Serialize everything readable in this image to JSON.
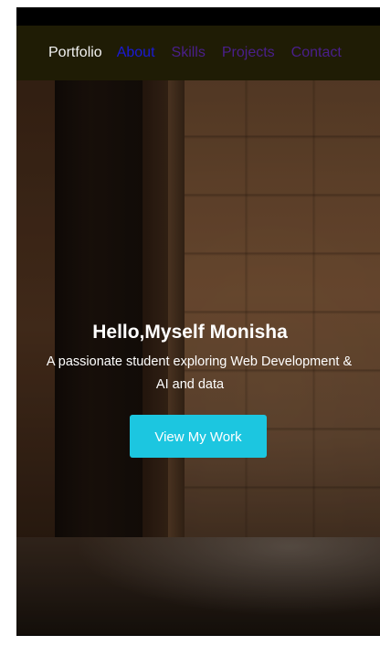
{
  "navbar": {
    "brand": "Portfolio",
    "links": [
      {
        "label": "About",
        "state": "active"
      },
      {
        "label": "Skills",
        "state": "visited"
      },
      {
        "label": "Projects",
        "state": "visited"
      },
      {
        "label": "Contact",
        "state": "visited"
      }
    ]
  },
  "hero": {
    "title": "Hello,Myself Monisha",
    "subtitle_line1": "A passionate student exploring Web Development &",
    "subtitle_line2": "AI and data",
    "cta_label": "View My Work"
  },
  "colors": {
    "navbar_bg": "#1f1c05",
    "active_link": "#1a1ad6",
    "visited_link": "#4a1f8c",
    "cta_bg": "#1cc6e0"
  }
}
